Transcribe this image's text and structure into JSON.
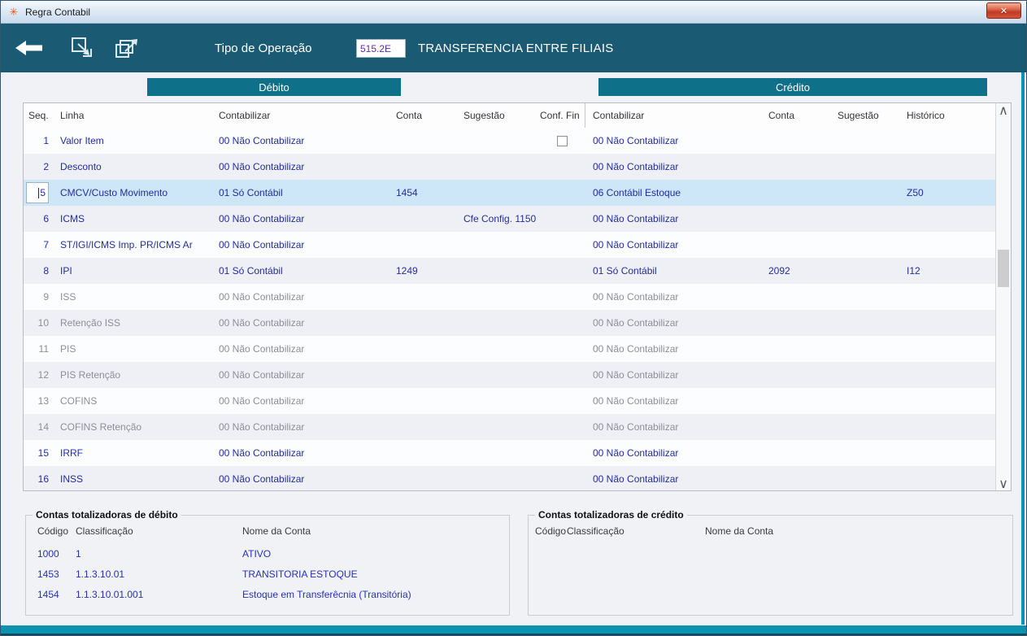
{
  "window": {
    "title": "Regra Contabil",
    "close_glyph": "✕",
    "app_icon_glyph": "✳"
  },
  "toolbar": {
    "operation_label": "Tipo de Operação",
    "operation_code": "515.2E",
    "operation_name": "TRANSFERENCIA ENTRE FILIAIS"
  },
  "section_bars": {
    "debit": "Débito",
    "credit": "Crédito"
  },
  "colors": {
    "toolbar_teal": "#1a5b73",
    "section_bar_teal": "#0f7089",
    "selected_row": "#cde6f8",
    "active_text_blue": "#232d9f",
    "disabled_text_gray": "#8e8e98",
    "accent_teal": "#0e93ae",
    "close_button_red": "#c03a22"
  },
  "table": {
    "columns": {
      "seq": "Seq.",
      "linha": "Linha",
      "contabilizar": "Contabilizar",
      "conta": "Conta",
      "sugestao": "Sugestão",
      "conf_fin": "Conf. Fin",
      "historico": "Histórico"
    },
    "scrollbar": {
      "up_glyph": "∧",
      "down_glyph": "∨"
    },
    "rows": [
      {
        "seq": "1",
        "linha": "Valor Item",
        "debit_contabilizar": "00 Não Contabilizar",
        "debit_conta": "",
        "debit_sugestao": "",
        "conf_fin_checkbox": true,
        "conf_fin_checked": false,
        "credit_contabilizar": "00 Não Contabilizar",
        "credit_conta": "",
        "credit_sugestao": "",
        "historico": "",
        "state": "active"
      },
      {
        "seq": "2",
        "linha": "Desconto",
        "debit_contabilizar": "00 Não Contabilizar",
        "debit_conta": "",
        "debit_sugestao": "",
        "conf_fin_checkbox": false,
        "credit_contabilizar": "00 Não Contabilizar",
        "credit_conta": "",
        "credit_sugestao": "",
        "historico": "",
        "state": "active"
      },
      {
        "seq": "5",
        "linha": "CMCV/Custo Movimento",
        "debit_contabilizar": "01 Só Contábil",
        "debit_conta": "1454",
        "debit_sugestao": "",
        "conf_fin_checkbox": false,
        "credit_contabilizar": "06 Contábil Estoque",
        "credit_conta": "",
        "credit_sugestao": "",
        "historico": "Z50",
        "state": "selected"
      },
      {
        "seq": "6",
        "linha": "ICMS",
        "debit_contabilizar": "00 Não Contabilizar",
        "debit_conta": "",
        "debit_sugestao": "Cfe Config. 1150",
        "conf_fin_checkbox": false,
        "credit_contabilizar": "00 Não Contabilizar",
        "credit_conta": "",
        "credit_sugestao": "",
        "historico": "",
        "state": "active"
      },
      {
        "seq": "7",
        "linha": "ST/IGI/ICMS Imp. PR/ICMS Ar",
        "debit_contabilizar": "00 Não Contabilizar",
        "debit_conta": "",
        "debit_sugestao": "",
        "conf_fin_checkbox": false,
        "credit_contabilizar": "00 Não Contabilizar",
        "credit_conta": "",
        "credit_sugestao": "",
        "historico": "",
        "state": "active"
      },
      {
        "seq": "8",
        "linha": "IPI",
        "debit_contabilizar": "01 Só Contábil",
        "debit_conta": "1249",
        "debit_sugestao": "",
        "conf_fin_checkbox": false,
        "credit_contabilizar": "01 Só Contábil",
        "credit_conta": "2092",
        "credit_sugestao": "",
        "historico": "I12",
        "state": "active"
      },
      {
        "seq": "9",
        "linha": "ISS",
        "debit_contabilizar": "00 Não Contabilizar",
        "debit_conta": "",
        "debit_sugestao": "",
        "conf_fin_checkbox": false,
        "credit_contabilizar": "00 Não Contabilizar",
        "credit_conta": "",
        "credit_sugestao": "",
        "historico": "",
        "state": "disabled"
      },
      {
        "seq": "10",
        "linha": "Retenção ISS",
        "debit_contabilizar": "00 Não Contabilizar",
        "debit_conta": "",
        "debit_sugestao": "",
        "conf_fin_checkbox": false,
        "credit_contabilizar": "00 Não Contabilizar",
        "credit_conta": "",
        "credit_sugestao": "",
        "historico": "",
        "state": "disabled"
      },
      {
        "seq": "11",
        "linha": "PIS",
        "debit_contabilizar": "00 Não Contabilizar",
        "debit_conta": "",
        "debit_sugestao": "",
        "conf_fin_checkbox": false,
        "credit_contabilizar": "00 Não Contabilizar",
        "credit_conta": "",
        "credit_sugestao": "",
        "historico": "",
        "state": "disabled"
      },
      {
        "seq": "12",
        "linha": "PIS Retenção",
        "debit_contabilizar": "00 Não Contabilizar",
        "debit_conta": "",
        "debit_sugestao": "",
        "conf_fin_checkbox": false,
        "credit_contabilizar": "00 Não Contabilizar",
        "credit_conta": "",
        "credit_sugestao": "",
        "historico": "",
        "state": "disabled"
      },
      {
        "seq": "13",
        "linha": "COFINS",
        "debit_contabilizar": "00 Não Contabilizar",
        "debit_conta": "",
        "debit_sugestao": "",
        "conf_fin_checkbox": false,
        "credit_contabilizar": "00 Não Contabilizar",
        "credit_conta": "",
        "credit_sugestao": "",
        "historico": "",
        "state": "disabled"
      },
      {
        "seq": "14",
        "linha": "COFINS Retenção",
        "debit_contabilizar": "00 Não Contabilizar",
        "debit_conta": "",
        "debit_sugestao": "",
        "conf_fin_checkbox": false,
        "credit_contabilizar": "00 Não Contabilizar",
        "credit_conta": "",
        "credit_sugestao": "",
        "historico": "",
        "state": "disabled"
      },
      {
        "seq": "15",
        "linha": "IRRF",
        "debit_contabilizar": "00 Não Contabilizar",
        "debit_conta": "",
        "debit_sugestao": "",
        "conf_fin_checkbox": false,
        "credit_contabilizar": "00 Não Contabilizar",
        "credit_conta": "",
        "credit_sugestao": "",
        "historico": "",
        "state": "active"
      },
      {
        "seq": "16",
        "linha": "INSS",
        "debit_contabilizar": "00 Não Contabilizar",
        "debit_conta": "",
        "debit_sugestao": "",
        "conf_fin_checkbox": false,
        "credit_contabilizar": "00 Não Contabilizar",
        "credit_conta": "",
        "credit_sugestao": "",
        "historico": "",
        "state": "active"
      }
    ]
  },
  "debit_totals": {
    "title": "Contas totalizadoras de débito",
    "columns": {
      "codigo": "Código",
      "classificacao": "Classificação",
      "nome": "Nome da Conta"
    },
    "rows": [
      {
        "codigo": "1000",
        "classificacao": "1",
        "nome": "ATIVO"
      },
      {
        "codigo": "1453",
        "classificacao": "1.1.3.10.01",
        "nome": "TRANSITORIA ESTOQUE"
      },
      {
        "codigo": "1454",
        "classificacao": "1.1.3.10.01.001",
        "nome": "Estoque em Transferêcnia (Transitória)"
      }
    ]
  },
  "credit_totals": {
    "title": "Contas totalizadoras de crédito",
    "columns": {
      "codigo": "Código",
      "classificacao": "Classificação",
      "nome": "Nome da Conta"
    },
    "rows": []
  }
}
